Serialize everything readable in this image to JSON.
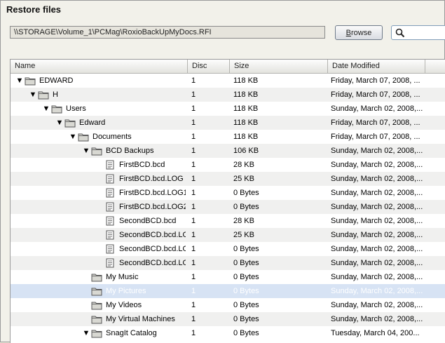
{
  "window": {
    "title": "Restore files"
  },
  "toolbar": {
    "path": "\\\\STORAGE\\Volume_1\\PCMag\\RoxioBackUpMyDocs.RFI",
    "browse_label_underlined": "B",
    "browse_label_rest": "rowse",
    "search_icon": "magnifier-icon",
    "search_value": ""
  },
  "columns": [
    {
      "label": "Name"
    },
    {
      "label": "Disc"
    },
    {
      "label": "Size"
    },
    {
      "label": "Date Modified"
    }
  ],
  "rows": [
    {
      "name": "EDWARD",
      "type": "folder",
      "expanded": true,
      "depth": 0,
      "disc": "1",
      "size": "118 KB",
      "date": "Friday, March 07, 2008, ..."
    },
    {
      "name": "H",
      "type": "folder",
      "expanded": true,
      "depth": 1,
      "disc": "1",
      "size": "118 KB",
      "date": "Friday, March 07, 2008, ..."
    },
    {
      "name": "Users",
      "type": "folder",
      "expanded": true,
      "depth": 2,
      "disc": "1",
      "size": "118 KB",
      "date": "Sunday, March 02, 2008,..."
    },
    {
      "name": "Edward",
      "type": "folder",
      "expanded": true,
      "depth": 3,
      "disc": "1",
      "size": "118 KB",
      "date": "Friday, March 07, 2008, ..."
    },
    {
      "name": "Documents",
      "type": "folder",
      "expanded": true,
      "depth": 4,
      "disc": "1",
      "size": "118 KB",
      "date": "Friday, March 07, 2008, ..."
    },
    {
      "name": "BCD Backups",
      "type": "folder",
      "expanded": true,
      "depth": 5,
      "disc": "1",
      "size": "106 KB",
      "date": "Sunday, March 02, 2008,..."
    },
    {
      "name": "FirstBCD.bcd",
      "type": "file",
      "depth": 6,
      "disc": "1",
      "size": "28 KB",
      "date": "Sunday, March 02, 2008,..."
    },
    {
      "name": "FirstBCD.bcd.LOG",
      "type": "file",
      "depth": 6,
      "disc": "1",
      "size": "25 KB",
      "date": "Sunday, March 02, 2008,..."
    },
    {
      "name": "FirstBCD.bcd.LOG1",
      "type": "file",
      "depth": 6,
      "disc": "1",
      "size": "0 Bytes",
      "date": "Sunday, March 02, 2008,..."
    },
    {
      "name": "FirstBCD.bcd.LOG2",
      "type": "file",
      "depth": 6,
      "disc": "1",
      "size": "0 Bytes",
      "date": "Sunday, March 02, 2008,..."
    },
    {
      "name": "SecondBCD.bcd",
      "type": "file",
      "depth": 6,
      "disc": "1",
      "size": "28 KB",
      "date": "Sunday, March 02, 2008,..."
    },
    {
      "name": "SecondBCD.bcd.LOG",
      "type": "file",
      "depth": 6,
      "disc": "1",
      "size": "25 KB",
      "date": "Sunday, March 02, 2008,..."
    },
    {
      "name": "SecondBCD.bcd.LO...",
      "type": "file",
      "depth": 6,
      "disc": "1",
      "size": "0 Bytes",
      "date": "Sunday, March 02, 2008,..."
    },
    {
      "name": "SecondBCD.bcd.LO...",
      "type": "file",
      "depth": 6,
      "disc": "1",
      "size": "0 Bytes",
      "date": "Sunday, March 02, 2008,..."
    },
    {
      "name": "My Music",
      "type": "folder",
      "expanded": false,
      "depth": 5,
      "disc": "1",
      "size": "0 Bytes",
      "date": "Sunday, March 02, 2008,..."
    },
    {
      "name": "My Pictures",
      "type": "folder",
      "expanded": false,
      "depth": 5,
      "disc": "1",
      "size": "0 Bytes",
      "date": "Sunday, March 02, 2008,...",
      "selected": true
    },
    {
      "name": "My Videos",
      "type": "folder",
      "expanded": false,
      "depth": 5,
      "disc": "1",
      "size": "0 Bytes",
      "date": "Sunday, March 02, 2008,..."
    },
    {
      "name": "My Virtual Machines",
      "type": "folder",
      "expanded": false,
      "depth": 5,
      "disc": "1",
      "size": "0 Bytes",
      "date": "Sunday, March 02, 2008,..."
    },
    {
      "name": "SnagIt Catalog",
      "type": "folder",
      "expanded": true,
      "depth": 5,
      "disc": "1",
      "size": "0 Bytes",
      "date": "Tuesday, March 04, 200..."
    }
  ]
}
